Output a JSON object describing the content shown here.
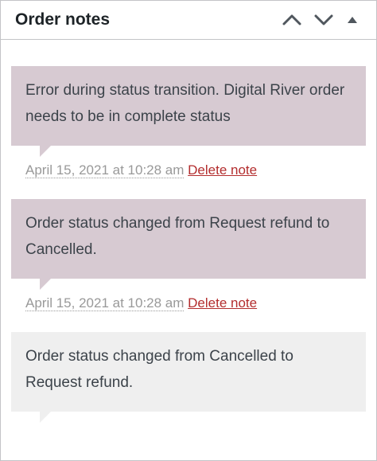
{
  "header": {
    "title": "Order notes",
    "controls": [
      "chevron-up-icon",
      "chevron-down-icon",
      "triangle-up-icon"
    ]
  },
  "notes": [
    {
      "content": "Error during status transition. Digital River order needs to be in complete status",
      "date": "April 15, 2021 at 10:28 am",
      "delete_label": "Delete note",
      "type": "customer"
    },
    {
      "content": "Order status changed from Request refund to Cancelled.",
      "date": "April 15, 2021 at 10:28 am",
      "delete_label": "Delete note",
      "type": "customer"
    },
    {
      "content": "Order status changed from Cancelled to Request refund.",
      "type": "system"
    }
  ],
  "colors": {
    "customer_note_bg": "#d7cad2",
    "system_note_bg": "#efefef",
    "delete_link": "#b32d2e",
    "meta_text": "#999999"
  }
}
